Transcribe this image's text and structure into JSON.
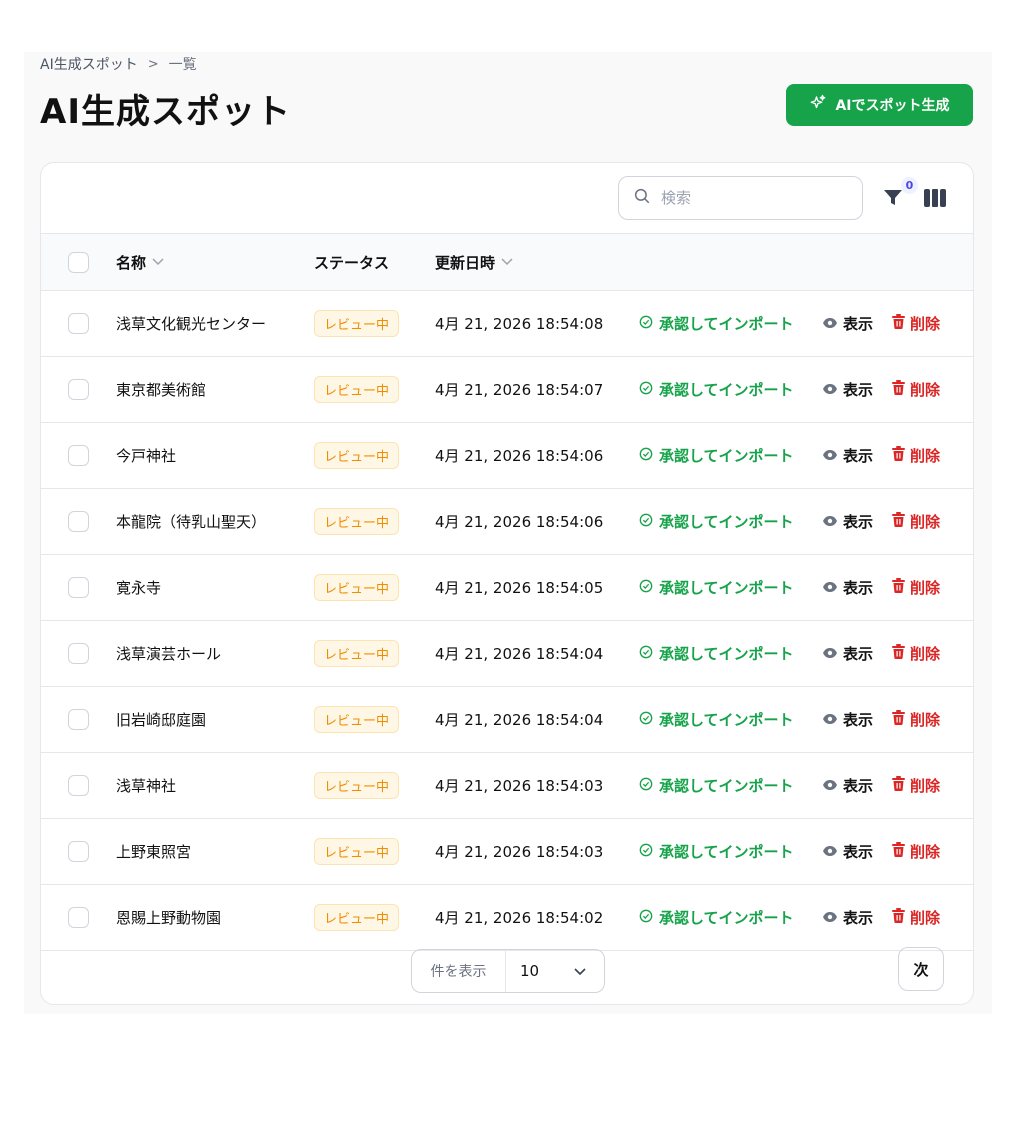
{
  "breadcrumb": {
    "parent": "AI生成スポット",
    "separator": ">",
    "current": "一覧"
  },
  "header": {
    "title": "AI生成スポット",
    "ai_button_label": "AIでスポット生成"
  },
  "toolbar": {
    "search_placeholder": "検索",
    "filter_count": "0"
  },
  "table": {
    "columns": {
      "name": "名称",
      "status": "ステータス",
      "updated": "更新日時"
    },
    "rows": [
      {
        "name": "浅草文化観光センター",
        "status": "レビュー中",
        "updated": "4月 21, 2026 18:54:08"
      },
      {
        "name": "東京都美術館",
        "status": "レビュー中",
        "updated": "4月 21, 2026 18:54:07"
      },
      {
        "name": "今戸神社",
        "status": "レビュー中",
        "updated": "4月 21, 2026 18:54:06"
      },
      {
        "name": "本龍院（待乳山聖天）",
        "status": "レビュー中",
        "updated": "4月 21, 2026 18:54:06"
      },
      {
        "name": "寛永寺",
        "status": "レビュー中",
        "updated": "4月 21, 2026 18:54:05"
      },
      {
        "name": "浅草演芸ホール",
        "status": "レビュー中",
        "updated": "4月 21, 2026 18:54:04"
      },
      {
        "name": "旧岩崎邸庭園",
        "status": "レビュー中",
        "updated": "4月 21, 2026 18:54:04"
      },
      {
        "name": "浅草神社",
        "status": "レビュー中",
        "updated": "4月 21, 2026 18:54:03"
      },
      {
        "name": "上野東照宮",
        "status": "レビュー中",
        "updated": "4月 21, 2026 18:54:03"
      },
      {
        "name": "恩賜上野動物園",
        "status": "レビュー中",
        "updated": "4月 21, 2026 18:54:02"
      }
    ],
    "actions": {
      "approve": "承認してインポート",
      "view": "表示",
      "delete": "削除"
    }
  },
  "pagination": {
    "per_page_label": "件を表示",
    "per_page_value": "10",
    "next_label": "次"
  },
  "colors": {
    "accent": "#16a34a",
    "danger": "#dc2626",
    "badge_text": "#f08c00",
    "badge_bg": "#fff7e6"
  }
}
